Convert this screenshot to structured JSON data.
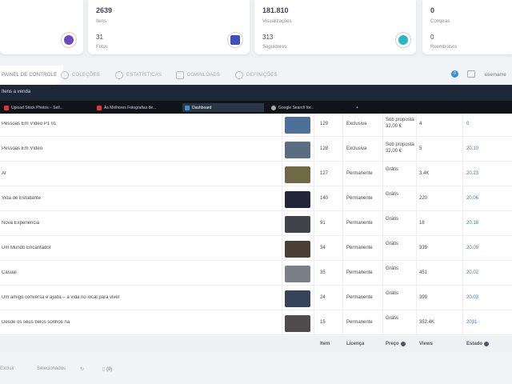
{
  "stats": {
    "cards": [
      {
        "big": "",
        "label": "",
        "small": "",
        "label2": "",
        "icon": "purple-circle-icon",
        "color": "#6b4bbf"
      },
      {
        "big": "2639",
        "label": "Itens",
        "small": "31",
        "label2": "Fotos",
        "icon": "chart-icon",
        "color": "#3f51b5"
      },
      {
        "big": "181.810",
        "label": "Visualizações",
        "small": "313",
        "label2": "Seguidores",
        "icon": "refresh-icon",
        "color": "#2eb5c4"
      },
      {
        "big": "0",
        "label": "Compras",
        "small": "0",
        "label2": "Reembolsos",
        "icon": "",
        "color": ""
      }
    ]
  },
  "tabs": [
    {
      "label": "Painel de controle",
      "icon": "dashboard-icon"
    },
    {
      "label": "Coleções",
      "icon": "collections-icon"
    },
    {
      "label": "Estatísticas",
      "icon": "stats-icon"
    },
    {
      "label": "Downloads",
      "icon": "download-icon"
    },
    {
      "label": "Definições",
      "icon": "settings-icon"
    }
  ],
  "toolbar": {
    "username": "username",
    "badge": "0"
  },
  "darkbar": {
    "text": "Itens a venda"
  },
  "browser_tabs": [
    {
      "label": "Upload Stock Photos – Sell..."
    },
    {
      "label": "As Melhores Fotografias de..."
    },
    {
      "label": "Dashboard"
    },
    {
      "label": "Google Search for..."
    }
  ],
  "rows": [
    {
      "title": "Pessoas Em Vídeo P1 01",
      "id": "129",
      "license": "Exclusiva",
      "price": [
        "Sob proposta",
        "32,00 €"
      ],
      "sold": "4",
      "last": "0",
      "thumb": "#4c7098"
    },
    {
      "title": "Pessoas Em Vídeo",
      "id": "128",
      "license": "Exclusiva",
      "price": [
        "Sob proposta",
        "32,00 €"
      ],
      "sold": "5",
      "last": "20.10",
      "thumb": "#5a6d82"
    },
    {
      "title": "Ar",
      "id": "127",
      "license": "Permanente",
      "price": [
        "Grátis",
        ""
      ],
      "sold": "3.4K",
      "last": "20.23",
      "thumb": "#6f6a45"
    },
    {
      "title": "Vida de Estudante",
      "id": "140",
      "license": "Permanente",
      "price": [
        "Grátis",
        ""
      ],
      "sold": "220",
      "last": "20.06",
      "thumb": "#23263a"
    },
    {
      "title": "Nova Experiência",
      "id": "91",
      "license": "Permanente",
      "price": [
        "Grátis",
        ""
      ],
      "sold": "18",
      "last": "20.18",
      "thumb": "#40434a"
    },
    {
      "title": "Um Mundo Encantador",
      "id": "34",
      "license": "Permanente",
      "price": [
        "Grátis",
        ""
      ],
      "sold": "339",
      "last": "20.09",
      "thumb": "#4b3e35"
    },
    {
      "title": "Casual",
      "id": "35",
      "license": "Permanente",
      "price": [
        "Grátis",
        ""
      ],
      "sold": "451",
      "last": "20.02",
      "thumb": "#7b8088"
    },
    {
      "title": "Um amigo conversa e ajuda – a vida no local para viver",
      "id": "24",
      "license": "Permanente",
      "price": [
        "Grátis",
        ""
      ],
      "sold": "399",
      "last": "20.03",
      "thumb": "#36435a"
    },
    {
      "title": "Desde os seus belos sonhos na",
      "id": "15",
      "license": "Permanente",
      "price": [
        "Grátis",
        ""
      ],
      "sold": "352.4K",
      "last": "2031",
      "thumb": "#4f4a4c"
    }
  ],
  "columns": {
    "id": "Item",
    "license": "Licença",
    "price": "Preço",
    "sold": "Views",
    "last": "Estado"
  },
  "footer": {
    "left": "Excluir",
    "mid": "Selecionados",
    "count": "(0)"
  }
}
